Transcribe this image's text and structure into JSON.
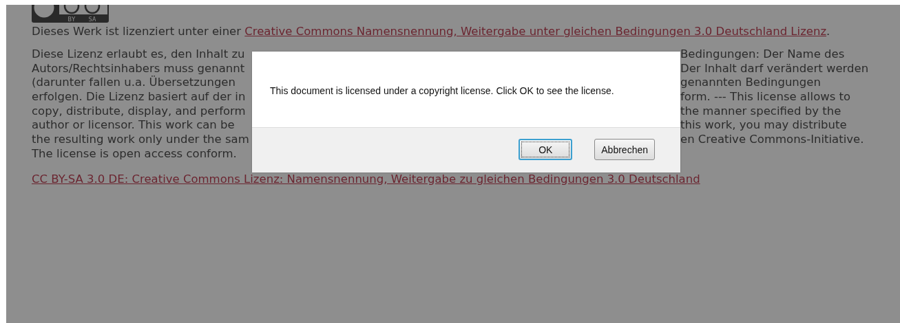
{
  "license_badge": {
    "labels": [
      "BY",
      "SA"
    ]
  },
  "license_line": {
    "text": "Dieses Werk ist lizenziert unter einer ",
    "link": "Creative Commons Namensnennung, Weitergabe unter gleichen Bedingungen 3.0 Deutschland Lizenz",
    "end": "."
  },
  "description_lines": [
    {
      "left": "Diese Lizenz erlaubt es, den Inhalt zu",
      "right": "Bedingungen: Der Name des"
    },
    {
      "left": "Autors/Rechtsinhabers muss genannt",
      "right": "Der Inhalt darf verändert werden"
    },
    {
      "left": "(darunter fallen u.a. Übersetzungen",
      "right": "genannten Bedingungen"
    },
    {
      "left": "erfolgen. Die Lizenz basiert auf der in",
      "right": "form. --- This license allows to"
    },
    {
      "left": "copy, distribute, display, and perform",
      "right": "the manner specified by the"
    },
    {
      "left": "author or licensor. This work can be",
      "right": "this work, you may distribute"
    },
    {
      "left": "the resulting work only under the sam",
      "right": "en Creative Commons-Initiative."
    },
    {
      "left": "The license is open access conform."
    }
  ],
  "bottom_link": "CC BY-SA 3.0 DE: Creative Commons Lizenz: Namensnennung, Weitergabe zu gleichen Bedingungen 3.0 Deutschland",
  "dialog": {
    "message": "This document is licensed under a copyright license. Click OK to see the license.",
    "buttons": [
      {
        "label": "OK",
        "focused": true
      },
      {
        "label": "Abbrechen",
        "focused": false
      }
    ]
  }
}
